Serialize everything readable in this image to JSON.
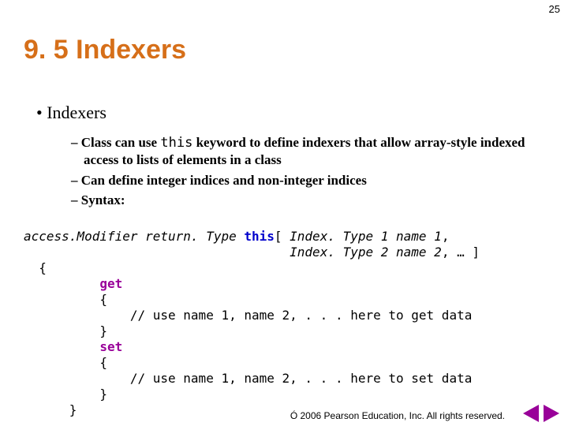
{
  "page_number": "25",
  "title": "9. 5 Indexers",
  "bullets": {
    "l1": "Indexers",
    "l2": [
      {
        "pre": "Class can use ",
        "code": "this",
        "post": " keyword to define indexers that allow array-style indexed access to lists of elements in a class"
      },
      {
        "pre": "Can define integer indices and non-integer indices",
        "code": "",
        "post": ""
      },
      {
        "pre": "Syntax:",
        "code": "",
        "post": ""
      }
    ]
  },
  "code": {
    "line1a": "access.Modifier return. Type ",
    "line1_this": "this",
    "line1b": "[ ",
    "line1_t1": "Index. Type 1 name 1",
    "line1c": ",",
    "line2pad": "                                   ",
    "line2_t2": "Index. Type 2 name 2",
    "line2b": ", … ]",
    "line3": "  {",
    "line4pad": "          ",
    "line4_get": "get",
    "line5": "          {",
    "line6": "              // use name 1, name 2, . . . here to get data",
    "line7": "          }",
    "line8pad": "          ",
    "line8_set": "set",
    "line9": "          {",
    "line10": "              // use name 1, name 2, . . . here to set data",
    "line11": "          }",
    "line12": "      }"
  },
  "footer": "Ó 2006 Pearson Education, Inc.  All rights reserved."
}
